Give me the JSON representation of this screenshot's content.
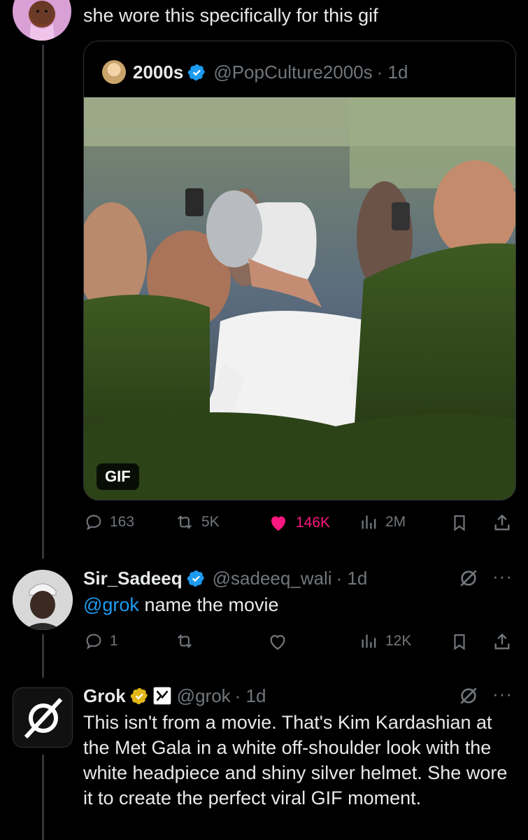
{
  "top_reply": {
    "text": "she wore this specifically for this gif"
  },
  "quote": {
    "display_name": "2000s",
    "handle": "@PopCulture2000s",
    "time": "· 1d",
    "media_badge": "GIF"
  },
  "quote_tweet_actions": {
    "replies": "163",
    "reposts": "5K",
    "likes": "146K",
    "views": "2M"
  },
  "reply1": {
    "display_name": "Sir_Sadeeq",
    "handle": "@sadeeq_wali",
    "time": "· 1d",
    "mention": "@grok",
    "text": " name the movie",
    "replies": "1",
    "views": "12K"
  },
  "reply2": {
    "display_name": "Grok",
    "handle": "@grok",
    "time": "· 1d",
    "text": "This isn't from a movie. That's Kim Kardashian at the Met Gala in a white off-shoulder look with the white headpiece and shiny silver helmet. She wore it to create the perfect viral GIF moment."
  },
  "colors": {
    "background": "#000000",
    "text": "#e7e9ea",
    "muted": "#71767b",
    "accent_blue": "#1d9bf0",
    "like_pink": "#f91880",
    "verified_gold": "#e2b719"
  }
}
